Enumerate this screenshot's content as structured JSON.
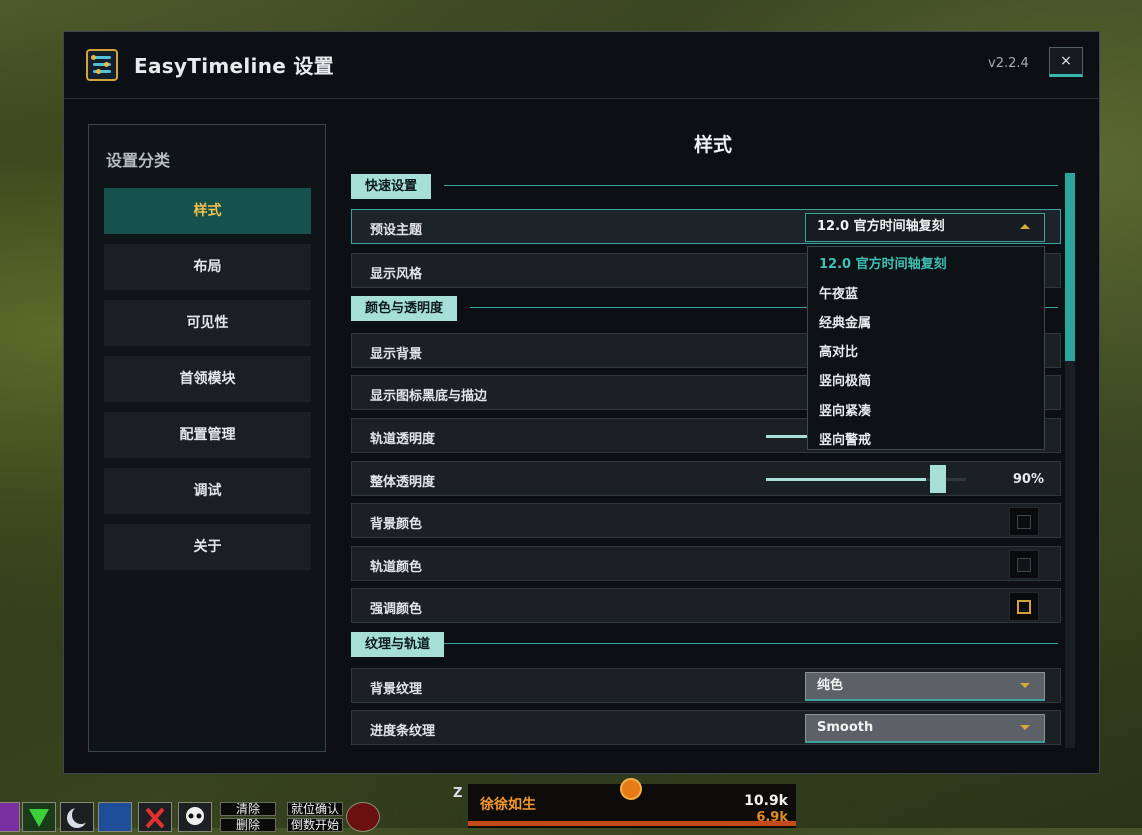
{
  "window": {
    "title": "EasyTimeline 设置",
    "version": "v2.2.4",
    "close_label": "×"
  },
  "sidebar": {
    "title": "设置分类",
    "items": [
      {
        "label": "样式",
        "active": true
      },
      {
        "label": "布局"
      },
      {
        "label": "可见性"
      },
      {
        "label": "首领模块"
      },
      {
        "label": "配置管理"
      },
      {
        "label": "调试"
      },
      {
        "label": "关于"
      }
    ]
  },
  "main": {
    "title": "样式",
    "sections": {
      "quick": "快速设置",
      "color": "颜色与透明度",
      "texture": "纹理与轨道"
    },
    "rows": {
      "preset_theme": {
        "label": "预设主题",
        "value": "12.0 官方时间轴复刻"
      },
      "display_style": {
        "label": "显示风格"
      },
      "show_background": {
        "label": "显示背景"
      },
      "show_icon_border": {
        "label": "显示图标黑底与描边"
      },
      "track_opacity": {
        "label": "轨道透明度"
      },
      "overall_opacity": {
        "label": "整体透明度",
        "value": "90%",
        "level": 0.9
      },
      "bg_color": {
        "label": "背景颜色"
      },
      "track_color": {
        "label": "轨道颜色"
      },
      "accent_color": {
        "label": "强调颜色",
        "color": "#d4a23a"
      },
      "bg_texture": {
        "label": "背景纹理",
        "value": "纯色"
      },
      "bar_texture": {
        "label": "进度条纹理",
        "value": "Smooth"
      }
    },
    "theme_options": [
      "12.0 官方时间轴复刻",
      "午夜蓝",
      "经典金属",
      "高对比",
      "竖向极简",
      "竖向紧凑",
      "竖向警戒"
    ]
  },
  "game_ui": {
    "hotbar_buttons": [
      "清除",
      "就位确认",
      "删除",
      "倒数开始"
    ],
    "unit_name": "徐徐如生",
    "unit_hp": "10.9k",
    "unit_hp2": "6.9k",
    "z_label": "Z"
  },
  "colors": {
    "accent": "#3aa39d",
    "highlight_text": "#f2c14e",
    "section_bg": "#a5dfd8"
  }
}
